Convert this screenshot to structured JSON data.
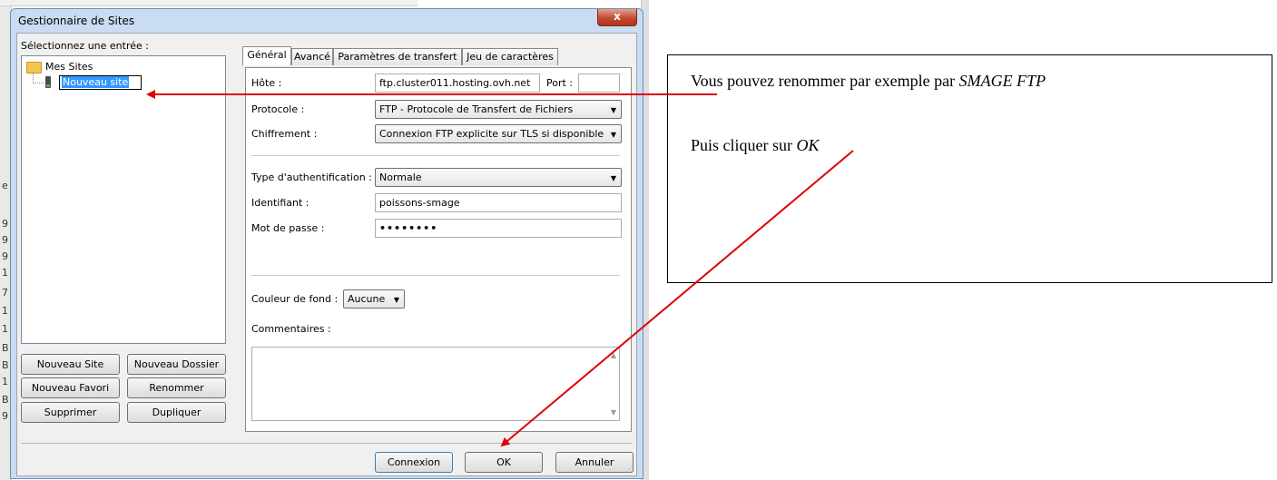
{
  "window": {
    "title": "Gestionnaire de Sites",
    "close_glyph": "x"
  },
  "left": {
    "select_label": "Sélectionnez une entrée :",
    "tree_root": "Mes Sites",
    "tree_item_editing": "Nouveau site",
    "buttons": {
      "new_site": "Nouveau Site",
      "new_folder": "Nouveau Dossier",
      "new_bookmark": "Nouveau Favori",
      "rename": "Renommer",
      "delete": "Supprimer",
      "duplicate": "Dupliquer"
    }
  },
  "tabs": [
    "Général",
    "Avancé",
    "Paramètres de transfert",
    "Jeu de caractères"
  ],
  "general": {
    "host_label": "Hôte :",
    "host_value": "ftp.cluster011.hosting.ovh.net",
    "port_label": "Port :",
    "port_value": "",
    "protocol_label": "Protocole :",
    "protocol_value": "FTP - Protocole de Transfert de Fichiers",
    "encryption_label": "Chiffrement :",
    "encryption_value": "Connexion FTP explicite sur TLS si disponible",
    "auth_label": "Type d'authentification :",
    "auth_value": "Normale",
    "user_label": "Identifiant :",
    "user_value": "poissons-smage",
    "password_label": "Mot de passe :",
    "password_value": "••••••••",
    "bgcolor_label": "Couleur de fond :",
    "bgcolor_value": "Aucune",
    "comments_label": "Commentaires :"
  },
  "footer": {
    "connect": "Connexion",
    "ok": "OK",
    "cancel": "Annuler"
  },
  "annotation": {
    "line1_text": "Vous pouvez renommer par exemple par ",
    "line1_em": "SMAGE FTP",
    "line2_text": "Puis cliquer sur ",
    "line2_em": "OK",
    "arrow_color": "#e00000"
  },
  "background_edge_chars": [
    "e",
    "9",
    "9",
    "9",
    "1",
    "7",
    "1",
    "1",
    "B",
    "B",
    "1",
    "B",
    "9"
  ]
}
